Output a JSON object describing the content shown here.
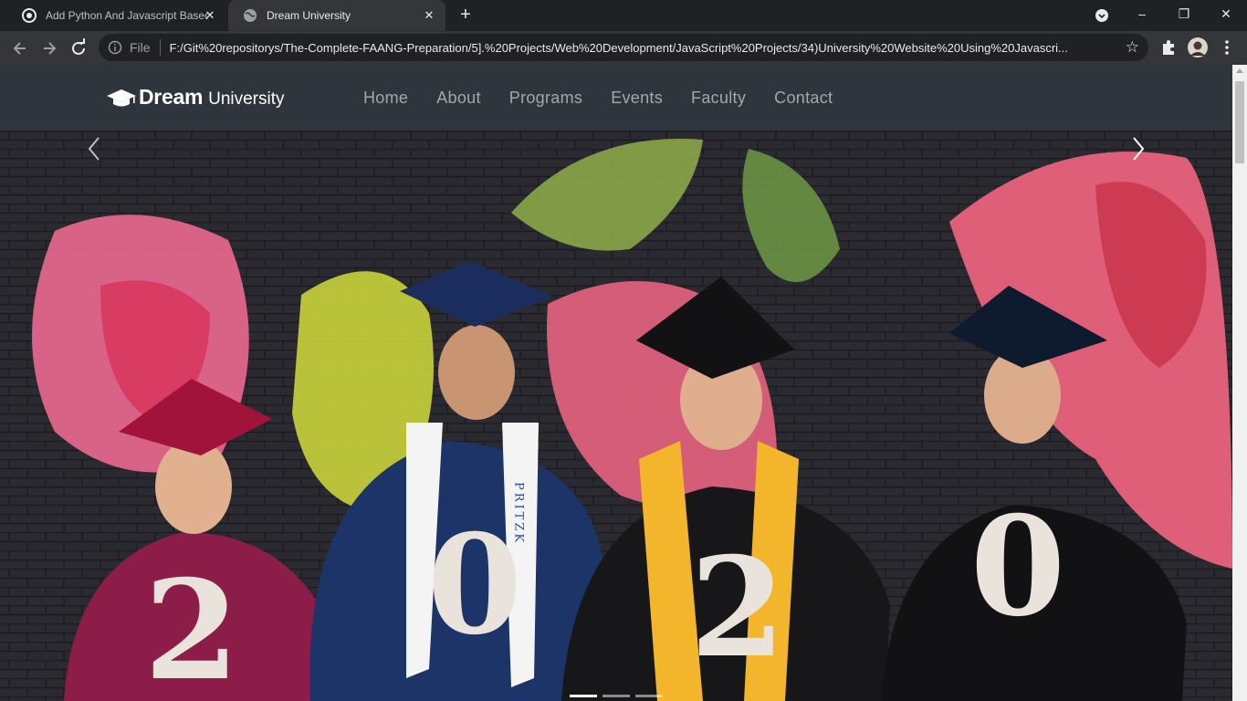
{
  "browser": {
    "tabs": [
      {
        "title": "Add Python And Javascript Based",
        "active": false,
        "close": "✕"
      },
      {
        "title": "Dream University",
        "active": true,
        "close": "✕"
      }
    ],
    "new_tab": "+",
    "omnibox": {
      "file_label": "File",
      "url": "F:/Git%20repositorys/The-Complete-FAANG-Preparation/5].%20Projects/Web%20Development/JavaScript%20Projects/34)University%20Website%20Using%20Javascri..."
    },
    "window_controls": {
      "minimize": "–",
      "restore": "❐",
      "close": "✕"
    }
  },
  "site": {
    "logo": {
      "bold": "Dream",
      "light": "University"
    },
    "nav": [
      "Home",
      "About",
      "Programs",
      "Events",
      "Faculty",
      "Contact"
    ],
    "hero": {
      "numbers": [
        "2",
        "0",
        "2",
        "0"
      ],
      "stole_text": "PRITZK",
      "active_slide": 1,
      "slide_count": 3
    }
  },
  "colors": {
    "chrome_dark": "#202124",
    "chrome_toolbar": "#35363a",
    "site_nav": "#2f353c",
    "nav_link": "#a5a7aa"
  }
}
